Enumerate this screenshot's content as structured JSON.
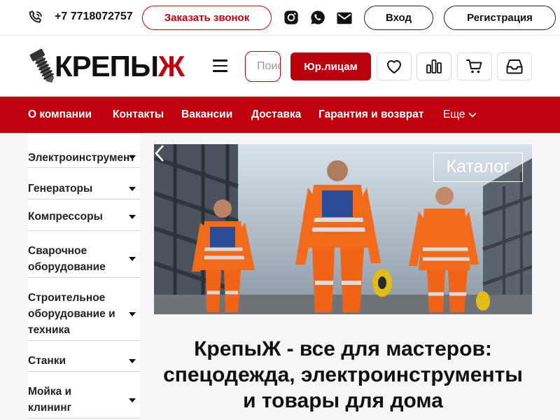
{
  "topbar": {
    "phone": "+7 7718072757",
    "callback_label": "Заказать звонок",
    "social": [
      "instagram-icon",
      "whatsapp-icon",
      "mail-icon"
    ],
    "login_label": "Вход",
    "register_label": "Регистрация"
  },
  "header": {
    "logo_text_main": "КРЕПЫ",
    "logo_text_accent": "Ж",
    "search_placeholder": "Поиск",
    "jur_label": "Юр.лицам",
    "icons": [
      "heart-icon",
      "compare-icon",
      "cart-icon",
      "inbox-icon"
    ]
  },
  "nav": {
    "items": [
      "О компании",
      "Контакты",
      "Вакансии",
      "Доставка",
      "Гарантия и возврат"
    ],
    "more_label": "Еще"
  },
  "sidebar": {
    "categories": [
      "Электроинструмент",
      "Генераторы",
      "Компрессоры",
      "Сварочное оборудование",
      "Строительное оборудование и техника",
      "Станки",
      "Мойка и клининг"
    ]
  },
  "banner": {
    "catalog_label": "Каталог"
  },
  "main": {
    "headline": "КрепыЖ - все для мастеров: спецодежда, электроинструменты и товары для дома"
  },
  "colors": {
    "brand_red": "#c1000f",
    "workwear_orange": "#f26a1b"
  }
}
